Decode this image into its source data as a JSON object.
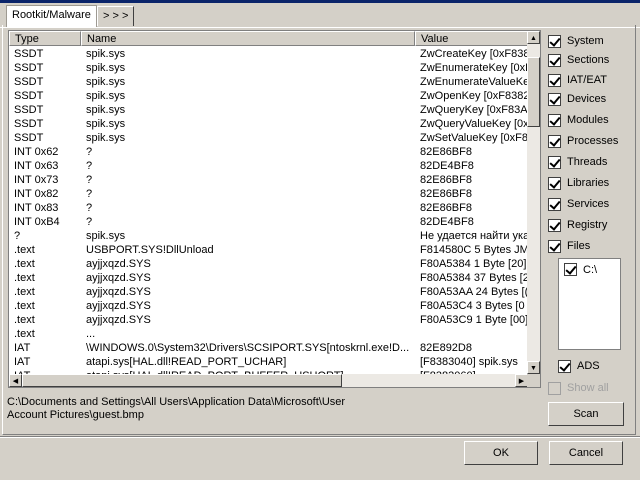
{
  "tabs": [
    {
      "label": "Rootkit/Malware",
      "active": true
    },
    {
      "label": "> > >",
      "active": false
    }
  ],
  "columns": [
    "Type",
    "Name",
    "Value"
  ],
  "rows": [
    [
      "SSDT",
      "spik.sys",
      "ZwCreateKey [0xF8382"
    ],
    [
      "SSDT",
      "spik.sys",
      "ZwEnumerateKey [0xF"
    ],
    [
      "SSDT",
      "spik.sys",
      "ZwEnumerateValueKe"
    ],
    [
      "SSDT",
      "spik.sys",
      "ZwOpenKey [0xF8382"
    ],
    [
      "SSDT",
      "spik.sys",
      "ZwQueryKey [0xF83A"
    ],
    [
      "SSDT",
      "spik.sys",
      "ZwQueryValueKey [0x"
    ],
    [
      "SSDT",
      "spik.sys",
      "ZwSetValueKey [0xF8"
    ],
    [
      "INT 0x62",
      "?",
      "82E86BF8"
    ],
    [
      "INT 0x63",
      "?",
      "82DE4BF8"
    ],
    [
      "INT 0x73",
      "?",
      "82E86BF8"
    ],
    [
      "INT 0x82",
      "?",
      "82E86BF8"
    ],
    [
      "INT 0x83",
      "?",
      "82E86BF8"
    ],
    [
      "INT 0xB4",
      "?",
      "82DE4BF8"
    ],
    [
      "?",
      "spik.sys",
      "Не удается найти ука"
    ],
    [
      ".text",
      "USBPORT.SYS!DllUnload",
      "F814580C 5 Bytes  JM"
    ],
    [
      ".text",
      "ayjjxqzd.SYS",
      "F80A5384 1 Byte  [20]"
    ],
    [
      ".text",
      "ayjjxqzd.SYS",
      "F80A5384 37 Bytes  [2"
    ],
    [
      ".text",
      "ayjjxqzd.SYS",
      "F80A53AA 24 Bytes  [("
    ],
    [
      ".text",
      "ayjjxqzd.SYS",
      "F80A53C4 3 Bytes  [0"
    ],
    [
      ".text",
      "ayjjxqzd.SYS",
      "F80A53C9 1 Byte  [00]"
    ],
    [
      ".text",
      "...",
      ""
    ],
    [
      "IAT",
      "\\WINDOWS.0\\System32\\Drivers\\SCSIPORT.SYS[ntoskrnl.exe!D...",
      "82E892D8"
    ],
    [
      "IAT",
      "atapi.sys[HAL.dll!READ_PORT_UCHAR]",
      "[F8383040] spik.sys"
    ],
    [
      "IAT",
      "atapi.sys[HAL.dll!READ_PORT_BUFFER_USHORT]",
      "[F8383060]"
    ]
  ],
  "checks": [
    {
      "label": "System",
      "checked": true
    },
    {
      "label": "Sections",
      "checked": true
    },
    {
      "label": "IAT/EAT",
      "checked": true
    },
    {
      "label": "Devices",
      "checked": true
    },
    {
      "label": "Modules",
      "checked": true
    },
    {
      "label": "Processes",
      "checked": true
    },
    {
      "label": "Threads",
      "checked": true
    },
    {
      "label": "Libraries",
      "checked": true
    },
    {
      "label": "Services",
      "checked": true
    },
    {
      "label": "Registry",
      "checked": true
    },
    {
      "label": "Files",
      "checked": true
    }
  ],
  "drives": [
    {
      "label": "C:\\",
      "checked": true
    }
  ],
  "ads": {
    "label": "ADS",
    "checked": true
  },
  "show_all": {
    "label": "Show all",
    "checked": false
  },
  "scan_label": "Scan",
  "path_line1": "C:\\Documents and Settings\\All Users\\Application Data\\Microsoft\\User",
  "path_line2": "Account Pictures\\guest.bmp",
  "ok_label": "OK",
  "cancel_label": "Cancel"
}
